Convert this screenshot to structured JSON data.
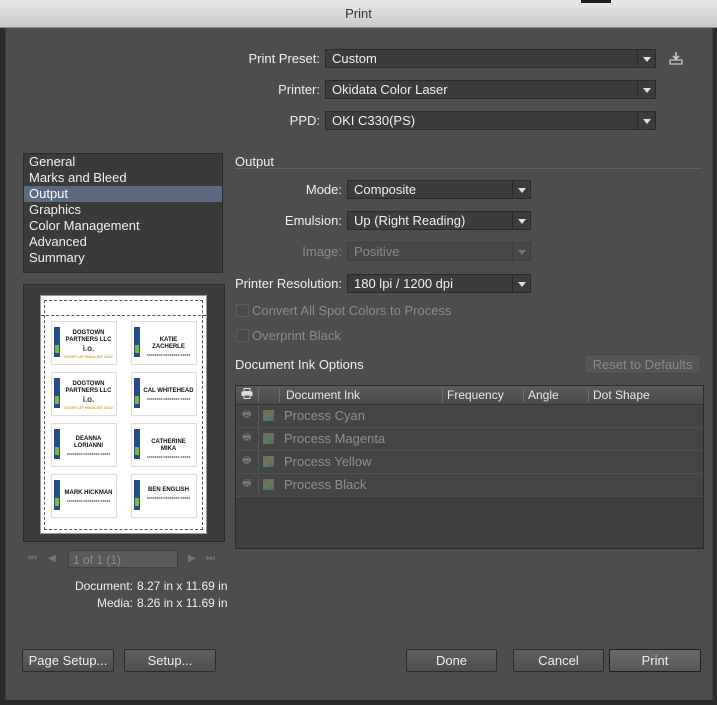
{
  "window": {
    "title": "Print"
  },
  "top": {
    "preset_label": "Print Preset:",
    "preset_value": "Custom",
    "printer_label": "Printer:",
    "printer_value": "Okidata Color Laser",
    "ppd_label": "PPD:",
    "ppd_value": "OKI C330(PS)"
  },
  "sidebar": {
    "items": [
      {
        "label": "General"
      },
      {
        "label": "Marks and Bleed"
      },
      {
        "label": "Output"
      },
      {
        "label": "Graphics"
      },
      {
        "label": "Color Management"
      },
      {
        "label": "Advanced"
      },
      {
        "label": "Summary"
      }
    ],
    "selected": "Output"
  },
  "preview": {
    "cards": [
      {
        "name": "DOGTOWN PARTNERS LLC",
        "extra": "i.o.",
        "sub": "START-UP FINALIST 2012"
      },
      {
        "name": "KATIE ZACHERLE",
        "sub": "XXXXXXXX XXXXXXXX XXXXX"
      },
      {
        "name": "DOGTOWN PARTNERS LLC",
        "extra": "i.o.",
        "sub": "START-UP FINALIST 2012"
      },
      {
        "name": "CAL WHITEHEAD",
        "sub": "XXXXXXXX XXXXXXXX XXXXX"
      },
      {
        "name": "DEANNA LORIANNI",
        "sub": "XXXXXXXX XXXXXXXX XXXXX"
      },
      {
        "name": "CATHERINE MIKA",
        "sub": "XXXXXXXX XXXXXXXX XXXXX"
      },
      {
        "name": "MARK HICKMAN",
        "sub": "XXXXXXXX XXXXXXXX XXXXX"
      },
      {
        "name": "BEN ENGLISH",
        "sub": "XXXXXXXX XXXXXXXX XXXXX"
      }
    ]
  },
  "pager": {
    "value": "1 of 1 (1)"
  },
  "doc_info": {
    "document_label": "Document:",
    "document_value": "8.27 in x 11.69 in",
    "media_label": "Media:",
    "media_value": "8.26 in x 11.69 in"
  },
  "output": {
    "section_title": "Output",
    "mode_label": "Mode:",
    "mode_value": "Composite",
    "emulsion_label": "Emulsion:",
    "emulsion_value": "Up (Right Reading)",
    "image_label": "Image:",
    "image_value": "Positive",
    "resolution_label": "Printer Resolution:",
    "resolution_value": "180 lpi / 1200 dpi",
    "convert_spot_label": "Convert All Spot Colors to Process",
    "overprint_label": "Overprint Black"
  },
  "ink": {
    "title": "Document Ink Options",
    "reset_button": "Reset to Defaults",
    "columns": [
      "Document Ink",
      "Frequency",
      "Angle",
      "Dot Shape"
    ],
    "rows": [
      "Process Cyan",
      "Process Magenta",
      "Process Yellow",
      "Process Black"
    ]
  },
  "buttons": {
    "page_setup": "Page Setup...",
    "setup": "Setup...",
    "done": "Done",
    "cancel": "Cancel",
    "print": "Print"
  },
  "colors": {
    "selection": "#5b6a80",
    "dialog_bg": "#4d4d4d"
  }
}
